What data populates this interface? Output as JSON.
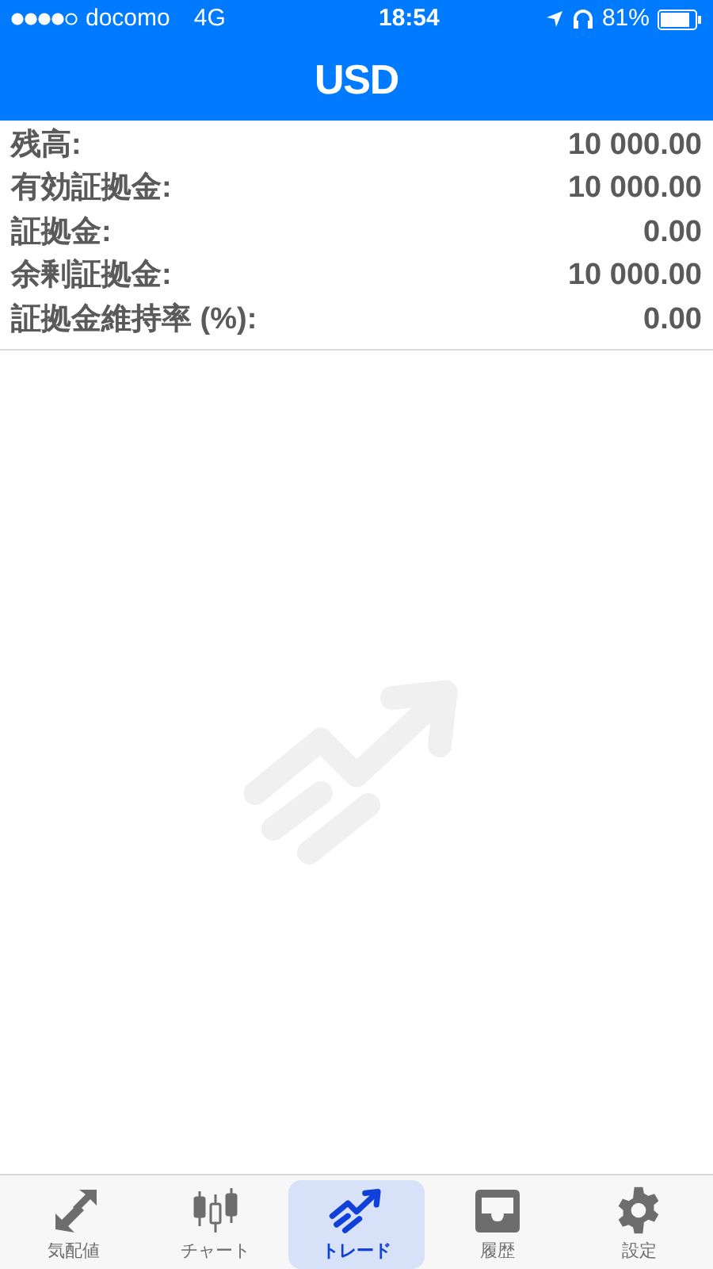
{
  "status_bar": {
    "carrier": "docomo",
    "network": "4G",
    "time": "18:54",
    "battery": "81%"
  },
  "header": {
    "title": "USD"
  },
  "account": [
    {
      "label": "残高:",
      "value": "10 000.00"
    },
    {
      "label": "有効証拠金:",
      "value": "10 000.00"
    },
    {
      "label": "証拠金:",
      "value": "0.00"
    },
    {
      "label": "余剰証拠金:",
      "value": "10 000.00"
    },
    {
      "label": "証拠金維持率 (%):",
      "value": "0.00"
    }
  ],
  "tabs": [
    {
      "label": "気配値",
      "selected": false
    },
    {
      "label": "チャート",
      "selected": false
    },
    {
      "label": "トレード",
      "selected": true
    },
    {
      "label": "履歴",
      "selected": false
    },
    {
      "label": "設定",
      "selected": false
    }
  ]
}
